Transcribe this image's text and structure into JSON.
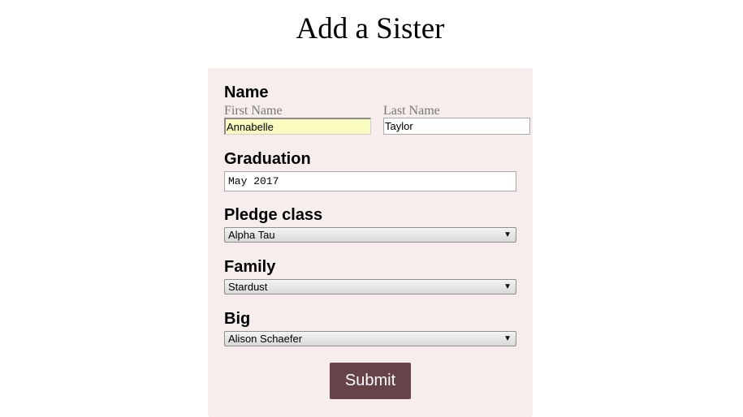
{
  "page": {
    "title": "Add a Sister"
  },
  "form": {
    "name": {
      "label": "Name",
      "first_label": "First Name",
      "first_value": "Annabelle",
      "last_label": "Last Name",
      "last_value": "Taylor"
    },
    "graduation": {
      "label": "Graduation",
      "value": "May 2017"
    },
    "pledge_class": {
      "label": "Pledge class",
      "selected": "Alpha Tau"
    },
    "family": {
      "label": "Family",
      "selected": "Stardust"
    },
    "big": {
      "label": "Big",
      "selected": "Alison Schaefer"
    },
    "submit_label": "Submit"
  },
  "icons": {
    "select_arrow": "caret-down-icon"
  },
  "colors": {
    "card_background": "#f7eded",
    "submit_background": "#654348",
    "autofill_background": "#fafcc0"
  }
}
